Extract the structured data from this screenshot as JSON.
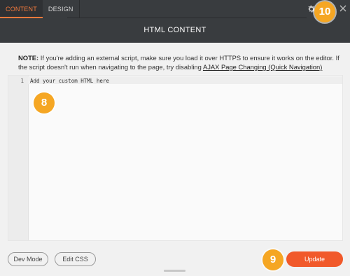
{
  "tabs": [
    {
      "label": "CONTENT",
      "active": true
    },
    {
      "label": "DESIGN",
      "active": false
    }
  ],
  "header": {
    "title": "HTML CONTENT",
    "settings_icon": "gear-icon",
    "close_icon": "close-icon"
  },
  "note": {
    "bold": "NOTE:",
    "text": " If you're adding an external script, make sure you load it over HTTPS to ensure it works on the editor. If the script doesn't run when navigating to the page, try disabling ",
    "link": "AJAX Page Changing (Quick Navigation)"
  },
  "editor": {
    "line_number": "1",
    "code": "Add your custom HTML here"
  },
  "footer": {
    "dev_mode_label": "Dev Mode",
    "edit_css_label": "Edit CSS",
    "update_label": "Update"
  },
  "callouts": {
    "editor_badge": "8",
    "update_badge": "9",
    "settings_badge": "10"
  },
  "colors": {
    "header_bg": "#393c3f",
    "accent": "#f47a3c",
    "update_button": "#f1592a",
    "callout": "#f5a623"
  }
}
